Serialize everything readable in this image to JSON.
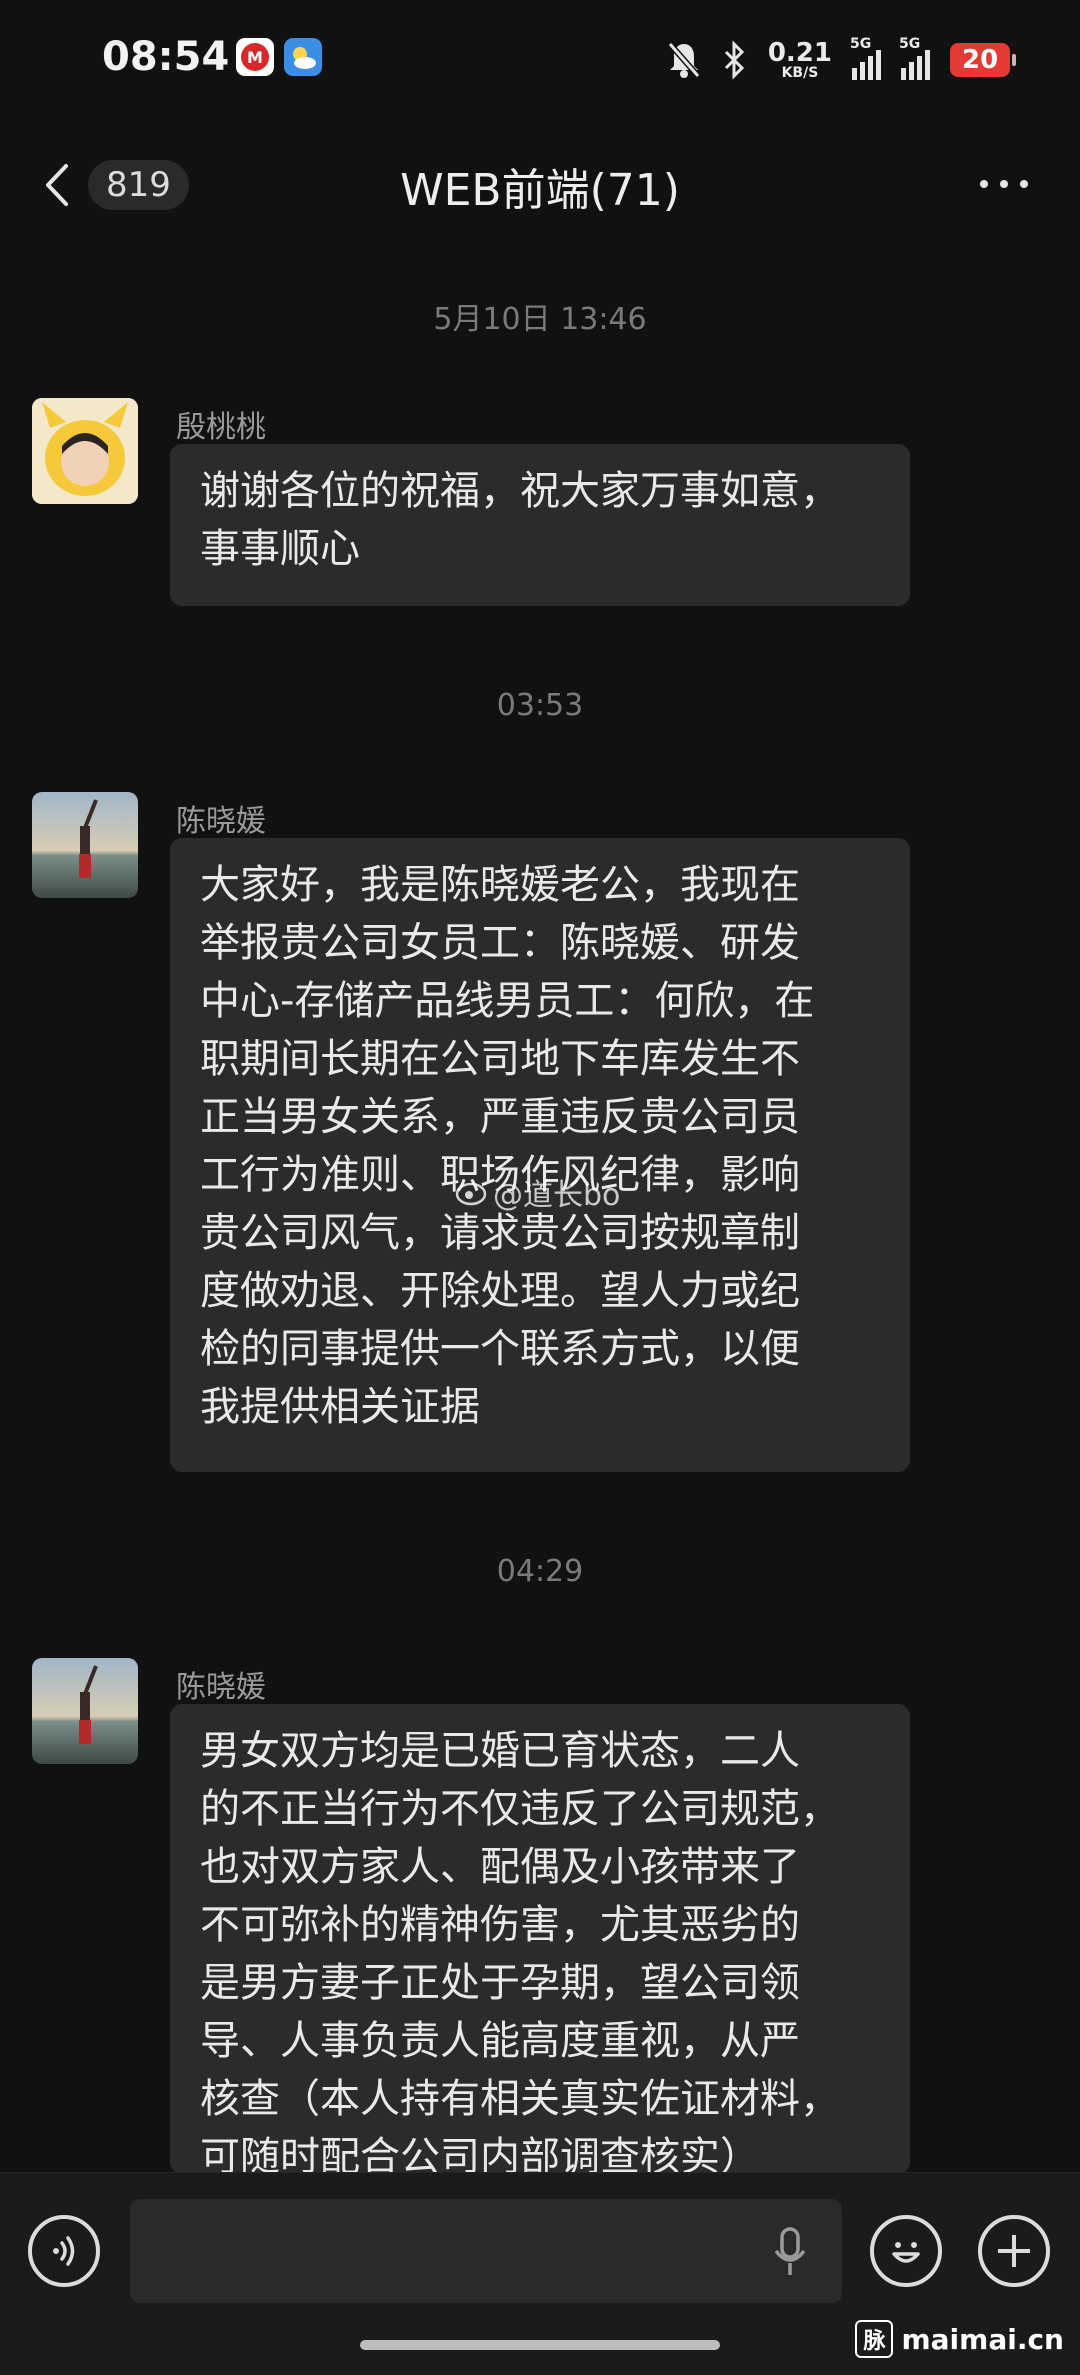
{
  "status": {
    "time": "08:54",
    "net_speed": "0.21",
    "net_unit": "KB/S",
    "sim1": "5G",
    "sim2": "5G",
    "battery": "20",
    "icons": [
      "app-m-icon",
      "weather-icon",
      "mute-bell-icon",
      "bluetooth-icon"
    ]
  },
  "nav": {
    "back_count": "819",
    "title": "WEB前端(71)"
  },
  "messages": [
    {
      "timestamp": "5月10日 13:46",
      "sender": "殷桃桃",
      "lines": [
        "谢谢各位的祝福，祝大家万事如意，",
        "事事顺心"
      ]
    },
    {
      "timestamp": "03:53",
      "sender": "陈晓媛",
      "lines": [
        "大家好，我是陈晓媛老公，我现在",
        "举报贵公司女员工：陈晓媛、研发",
        "中心-存储产品线男员工：何欣，在",
        "职期间长期在公司地下车库发生不",
        "正当男女关系，严重违反贵公司员",
        "工行为准则、职场作风纪律，影响",
        "贵公司风气，请求贵公司按规章制",
        "度做劝退、开除处理。望人力或纪",
        "检的同事提供一个联系方式，以便",
        "我提供相关证据"
      ]
    },
    {
      "timestamp": "04:29",
      "sender": "陈晓媛",
      "lines": [
        "男女双方均是已婚已育状态，二人",
        "的不正当行为不仅违反了公司规范，",
        "也对双方家人、配偶及小孩带来了",
        "不可弥补的精神伤害，尤其恶劣的",
        "是男方妻子正处于孕期，望公司领",
        "导、人事负责人能高度重视，从严",
        "核查（本人持有相关真实佐证材料，",
        "可随时配合公司内部调查核实）"
      ]
    }
  ],
  "overlay_watermark": "@道长bo",
  "input": {
    "placeholder": ""
  },
  "site_watermark": {
    "badge": "脉",
    "text": "maimai.cn"
  },
  "colors": {
    "background": "#111111",
    "bubble": "#2b2b2b",
    "battery": "#e53935"
  }
}
